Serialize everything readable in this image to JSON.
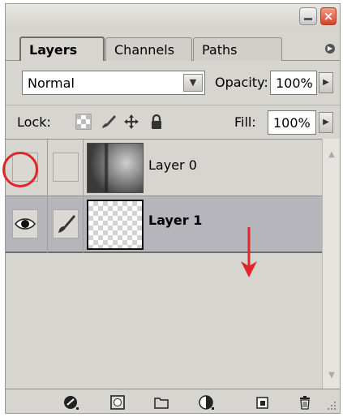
{
  "window": {
    "close_label": "×"
  },
  "tabs": [
    {
      "label": "Layers",
      "active": true
    },
    {
      "label": "Channels",
      "active": false
    },
    {
      "label": "Paths",
      "active": false
    }
  ],
  "panel_menu_icon": "arrow-right-icon",
  "blend": {
    "mode": "Normal",
    "opacity_label": "Opacity:",
    "opacity_value": "100%"
  },
  "lock": {
    "label": "Lock:",
    "fill_label": "Fill:",
    "fill_value": "100%",
    "icons": [
      "lock-transparent-icon",
      "lock-image-icon",
      "lock-position-icon",
      "lock-all-icon"
    ]
  },
  "layers": [
    {
      "name": "Layer 0",
      "visible": false,
      "selected": false,
      "thumbnail": "photo"
    },
    {
      "name": "Layer 1",
      "visible": true,
      "selected": true,
      "thumbnail": "transparent"
    }
  ],
  "bottom_icons": [
    "layer-style-icon",
    "add-mask-icon",
    "new-group-icon",
    "new-adjustment-icon",
    "new-layer-icon",
    "delete-layer-icon"
  ],
  "colors": {
    "panel_bg": "#d6d5cf",
    "selected_row": "#b6b5bc",
    "annotation_red": "#e0262a",
    "close_button": "#d9412a"
  }
}
